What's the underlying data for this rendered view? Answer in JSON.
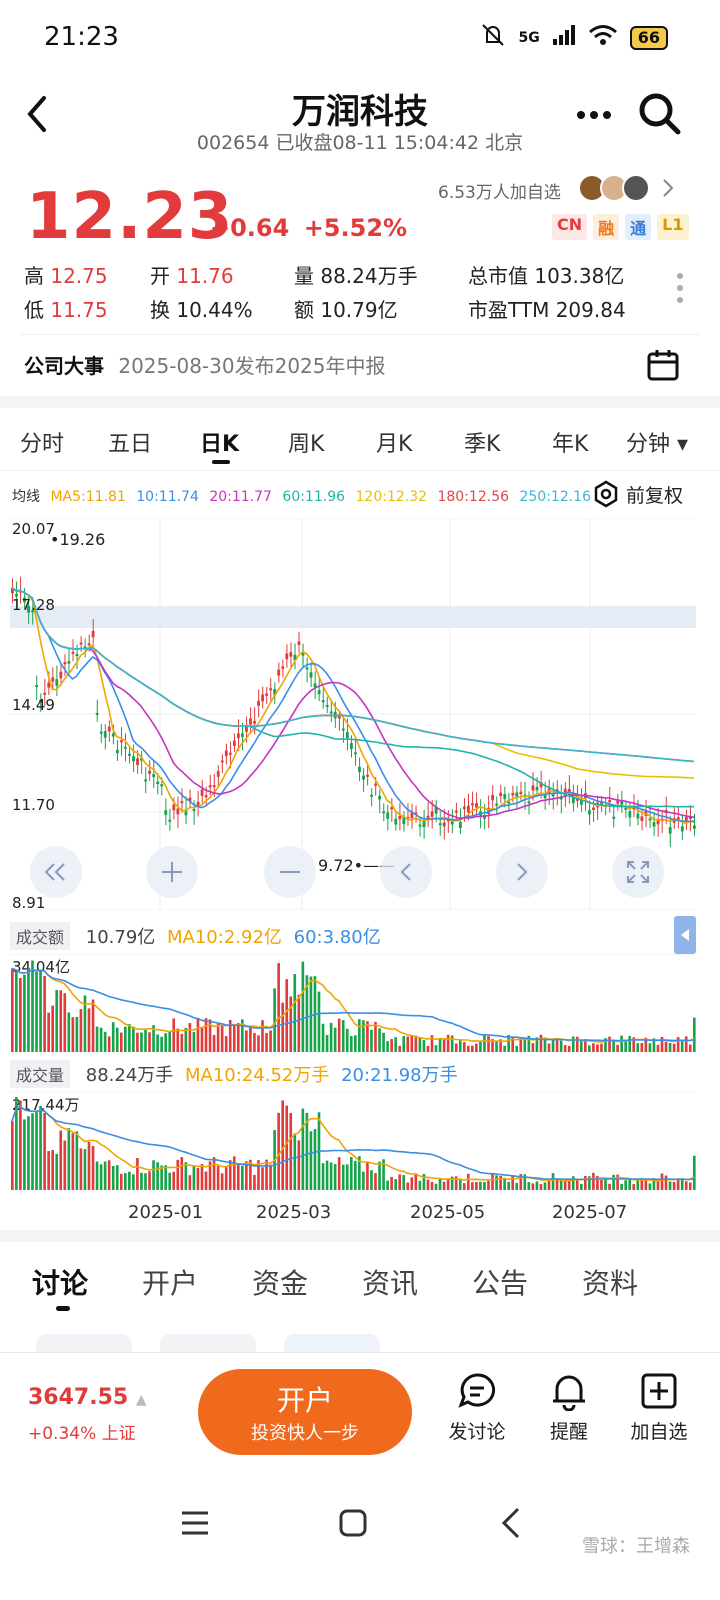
{
  "status": {
    "time": "21:23",
    "network": "5G",
    "battery": "66"
  },
  "header": {
    "title": "万润科技",
    "subtitle": "002654 已收盘08-11 15:04:42 北京",
    "more_icon": "more-dots-icon",
    "search_icon": "search-icon"
  },
  "quote": {
    "price": "12.23",
    "change": "+0.64",
    "change_pct": "+5.52%",
    "followers": "6.53万人加自选",
    "badges": [
      "CN",
      "融",
      "通",
      "L1"
    ],
    "high_label": "高",
    "high": "12.75",
    "low_label": "低",
    "low": "11.75",
    "open_label": "开",
    "open": "11.76",
    "turnover_label": "换",
    "turnover": "10.44%",
    "volume_label": "量",
    "volume": "88.24万手",
    "amount_label": "额",
    "amount": "10.79亿",
    "mktcap_label": "总市值",
    "mktcap": "103.38亿",
    "pe_label": "市盈TTM",
    "pe": "209.84"
  },
  "event": {
    "label": "公司大事",
    "text": "2025-08-30发布2025年中报"
  },
  "ktabs": [
    "分时",
    "五日",
    "日K",
    "周K",
    "月K",
    "季K",
    "年K",
    "分钟 ▾"
  ],
  "ktabs_active": 2,
  "ma": {
    "label": "均线",
    "items": [
      {
        "text": "MA5:11.81",
        "color": "#f0a500"
      },
      {
        "text": "10:11.74",
        "color": "#3a8ee6"
      },
      {
        "text": "20:11.77",
        "color": "#c235c2"
      },
      {
        "text": "60:11.96",
        "color": "#1fb5a8"
      },
      {
        "text": "120:12.32",
        "color": "#e8c000"
      },
      {
        "text": "180:12.56",
        "color": "#e04848"
      },
      {
        "text": "250:12.16",
        "color": "#38b6d6"
      }
    ],
    "adjust": "前复权"
  },
  "chart_labels": {
    "y_top": "20.07",
    "y_2": "17.28",
    "y_3": "14.49",
    "y_4": "11.70",
    "y_bottom": "8.91",
    "max_mark": "19.26",
    "min_mark": "9.72"
  },
  "amount_panel": {
    "tag": "成交额",
    "value": "10.79亿",
    "ma10": "MA10:2.92亿",
    "ma60": "60:3.80亿",
    "max": "34.04亿"
  },
  "volume_panel": {
    "tag": "成交量",
    "value": "88.24万手",
    "ma10": "MA10:24.52万手",
    "ma20": "20:21.98万手",
    "max": "217.44万"
  },
  "x_axis": [
    "2025-01",
    "2025-03",
    "2025-05",
    "2025-07"
  ],
  "bottom_tabs": [
    "讨论",
    "开户",
    "资金",
    "资讯",
    "公告",
    "资料"
  ],
  "bottom_tabs_active": 0,
  "index": {
    "value": "3647.55",
    "change": "+0.34% 上证"
  },
  "open_account": {
    "title": "开户",
    "subtitle": "投资快人一步"
  },
  "actions": [
    {
      "label": "发讨论",
      "icon": "comment-icon"
    },
    {
      "label": "提醒",
      "icon": "bell-icon"
    },
    {
      "label": "加自选",
      "icon": "add-box-icon"
    }
  ],
  "watermark": "雪球：王增森",
  "colors": {
    "up": "#e23b3b",
    "down": "#16a34a",
    "accent": "#f06a1e"
  }
}
